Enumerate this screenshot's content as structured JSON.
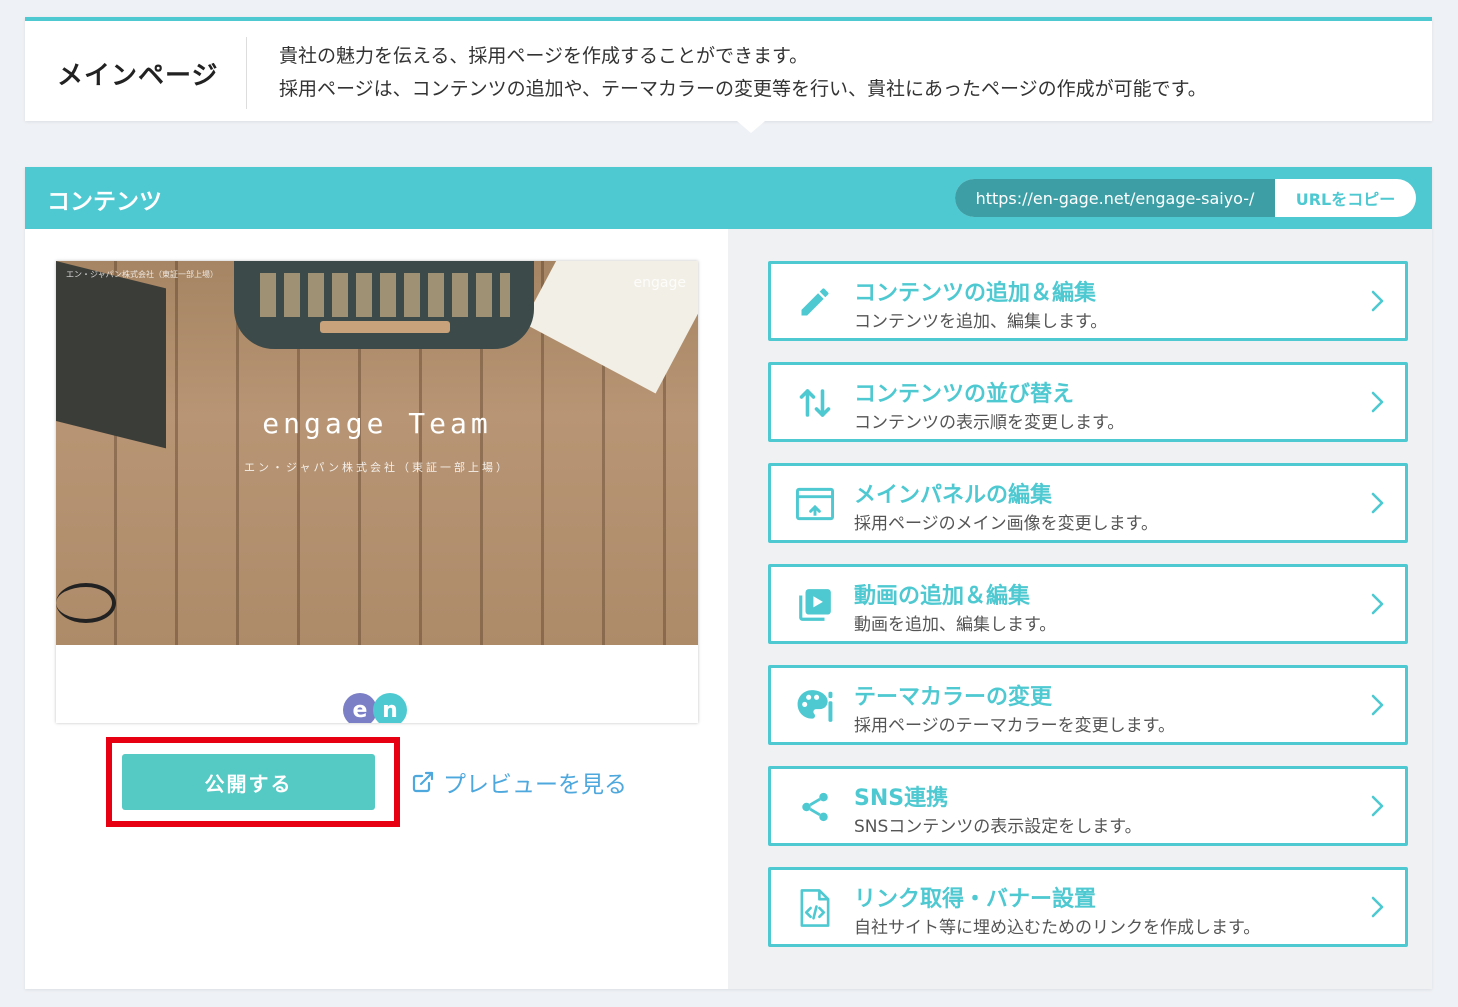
{
  "info": {
    "title": "メインページ",
    "line1": "貴社の魅力を伝える、採用ページを作成することができます。",
    "line2": "採用ページは、コンテンツの追加や、テーマカラーの変更等を行い、貴社にあったページの作成が可能です。"
  },
  "panel": {
    "title": "コンテンツ",
    "url": "https://en-gage.net/engage-saiyo-/",
    "copy_label": "URLをコピー"
  },
  "preview": {
    "badge_text": "エン・ジャパン株式会社（東証一部上場）",
    "logo_text": "engage",
    "main_text": "engage Team",
    "sub_text": "エン・ジャパン株式会社（東証一部上場）",
    "en_logo_e": "e",
    "en_logo_n": "n"
  },
  "actions": {
    "publish_label": "公開する",
    "preview_label": "プレビューを見る"
  },
  "menu": [
    {
      "icon": "pencil-icon",
      "title": "コンテンツの追加＆編集",
      "desc": "コンテンツを追加、編集します。"
    },
    {
      "icon": "sort-arrows-icon",
      "title": "コンテンツの並び替え",
      "desc": "コンテンツの表示順を変更します。"
    },
    {
      "icon": "main-panel-icon",
      "title": "メインパネルの編集",
      "desc": "採用ページのメイン画像を変更します。"
    },
    {
      "icon": "video-icon",
      "title": "動画の追加＆編集",
      "desc": "動画を追加、編集します。"
    },
    {
      "icon": "palette-icon",
      "title": "テーマカラーの変更",
      "desc": "採用ページのテーマカラーを変更します。"
    },
    {
      "icon": "share-icon",
      "title": "SNS連携",
      "desc": "SNSコンテンツの表示設定をします。"
    },
    {
      "icon": "code-file-icon",
      "title": "リンク取得・バナー設置",
      "desc": "自社サイト等に埋め込むためのリンクを作成します。"
    }
  ],
  "colors": {
    "accent": "#4ec9d1",
    "publish": "#55c9c4",
    "highlight": "#e60012",
    "link": "#4ea8dd"
  }
}
